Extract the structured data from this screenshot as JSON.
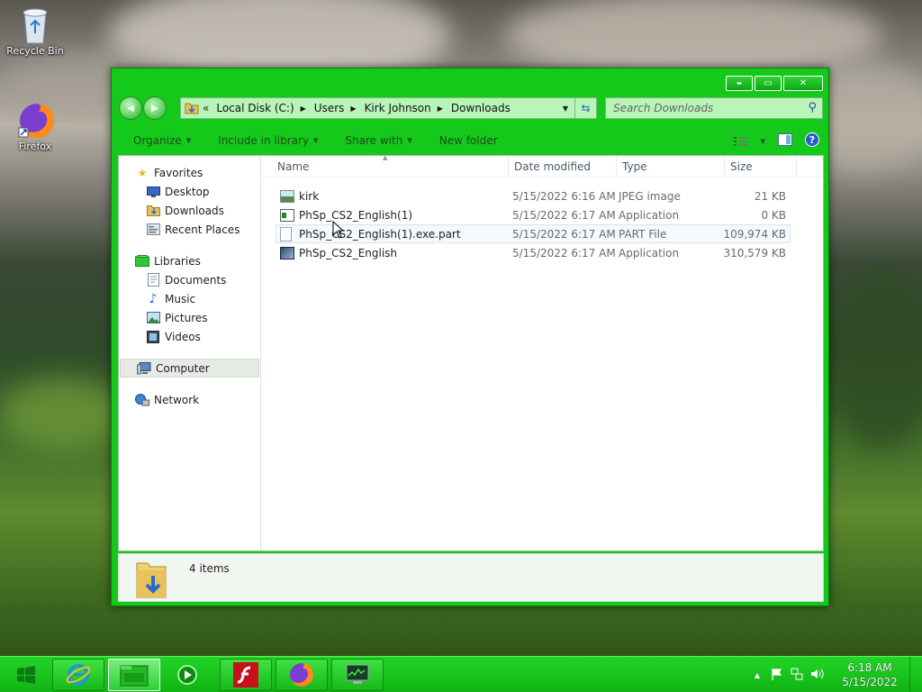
{
  "desktop": {
    "icons": [
      {
        "label": "Recycle Bin",
        "icon": "recycle-bin-icon"
      },
      {
        "label": "Firefox",
        "icon": "firefox-icon"
      }
    ]
  },
  "window": {
    "caption": {
      "minimize": "▬",
      "maximize": "▭",
      "close": "✕"
    },
    "nav": {
      "back": "◀",
      "forward": "▶"
    },
    "address": {
      "overflow": "«",
      "crumbs": [
        "Local Disk (C:)",
        "Users",
        "Kirk Johnson",
        "Downloads"
      ]
    },
    "search": {
      "placeholder": "Search Downloads"
    },
    "toolbar": {
      "organize": "Organize",
      "include": "Include in library",
      "share": "Share with",
      "newfolder": "New folder"
    },
    "sidebar": {
      "favorites": {
        "title": "Favorites",
        "items": [
          "Desktop",
          "Downloads",
          "Recent Places"
        ]
      },
      "libraries": {
        "title": "Libraries",
        "items": [
          "Documents",
          "Music",
          "Pictures",
          "Videos"
        ]
      },
      "computer": "Computer",
      "network": "Network"
    },
    "columns": [
      "Name",
      "Date modified",
      "Type",
      "Size"
    ],
    "files": [
      {
        "name": "kirk",
        "date": "5/15/2022 6:16 AM",
        "type": "JPEG image",
        "size": "21 KB",
        "icon": "jpeg-icon"
      },
      {
        "name": "PhSp_CS2_English(1)",
        "date": "5/15/2022 6:17 AM",
        "type": "Application",
        "size": "0 KB",
        "icon": "application-icon"
      },
      {
        "name": "PhSp_CS2_English(1).exe.part",
        "date": "5/15/2022 6:17 AM",
        "type": "PART File",
        "size": "109,974 KB",
        "icon": "blank-file-icon"
      },
      {
        "name": "PhSp_CS2_English",
        "date": "5/15/2022 6:17 AM",
        "type": "Application",
        "size": "310,579 KB",
        "icon": "installer-icon"
      }
    ],
    "status": {
      "count": "4 items"
    }
  },
  "taskbar": {
    "apps": [
      "internet-explorer-icon",
      "file-explorer-icon",
      "media-player-icon",
      "flash-icon",
      "firefox-icon",
      "task-manager-icon"
    ],
    "clock": {
      "time": "6:18 AM",
      "date": "5/15/2022"
    }
  }
}
